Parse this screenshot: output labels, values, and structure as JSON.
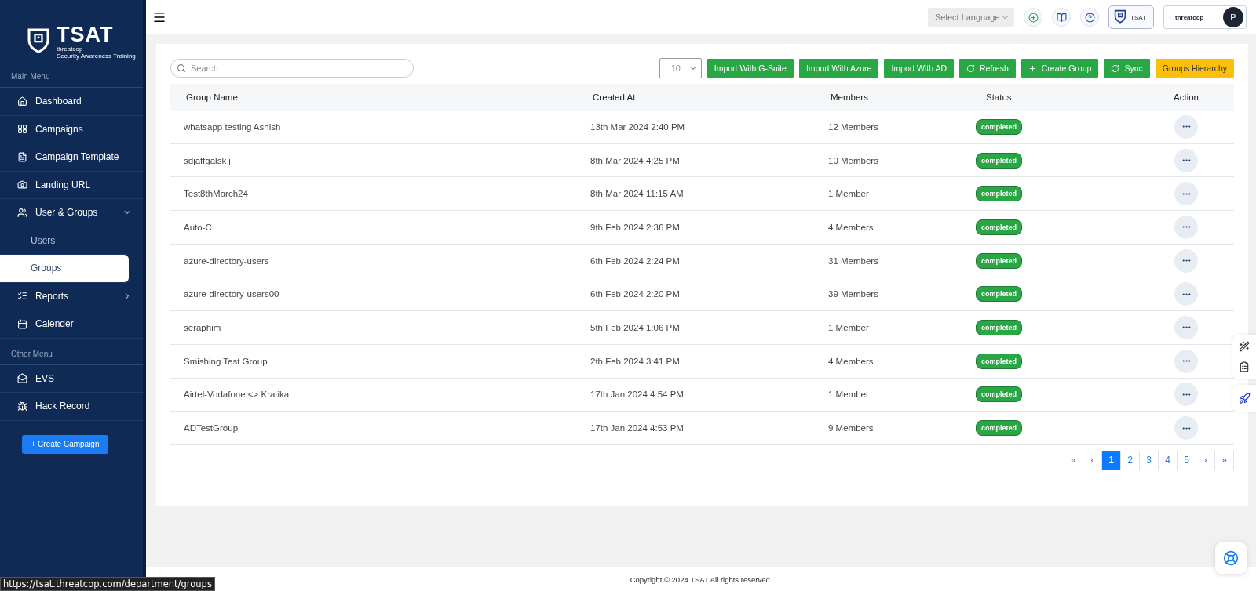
{
  "brand": {
    "title": "TSAT",
    "line_1": "threatcop",
    "line_2": "Security Awareness Training"
  },
  "main_menu": {
    "title": "Main Menu",
    "items": [
      {
        "label": "Dashboard",
        "kind": "item",
        "selected": false
      },
      {
        "label": "Campaigns",
        "kind": "item",
        "selected": false
      },
      {
        "label": "Campaign Template",
        "kind": "item",
        "selected": false
      },
      {
        "label": "Landing URL",
        "kind": "item",
        "selected": false
      },
      {
        "label": "User & Groups",
        "kind": "item",
        "selected": false,
        "expanded": true
      },
      {
        "label": "Users",
        "kind": "subitem",
        "selected": false
      },
      {
        "label": "Groups",
        "kind": "subitem",
        "selected": true
      },
      {
        "label": "Reports",
        "kind": "item",
        "selected": false,
        "expanded": false
      },
      {
        "label": "Calender",
        "kind": "item",
        "selected": false
      }
    ]
  },
  "other_menu": {
    "title": "Other Menu",
    "items": [
      {
        "label": "EVS",
        "kind": "item",
        "selected": false
      },
      {
        "label": "Hack Record",
        "kind": "item",
        "selected": false
      }
    ]
  },
  "create_campaign": "+ Create Campaign",
  "topbar": {
    "language": "Select Language",
    "product": "TSAT",
    "company": "threatcop",
    "avatar": "P"
  },
  "search": {
    "placeholder": "Search"
  },
  "page_size": "10",
  "buttons": [
    {
      "label": "Import With G-Suite",
      "kind": "import"
    },
    {
      "label": "Import With Azure",
      "kind": "import"
    },
    {
      "label": "Import With AD",
      "kind": "import"
    },
    {
      "label": "Refresh",
      "kind": "refresh"
    },
    {
      "label": "Create Group",
      "kind": "create"
    },
    {
      "label": "Sync",
      "kind": "sync"
    },
    {
      "label": "Groups Hierarchy",
      "kind": "hierarchy"
    }
  ],
  "table": {
    "columns": [
      "Group Name",
      "Created At",
      "Members",
      "Status",
      "Action"
    ],
    "rows": [
      {
        "name": "whatsapp testing Ashish",
        "created": "13th Mar 2024 2:40 PM",
        "members": "12 Members",
        "status": "completed"
      },
      {
        "name": "sdjaffgalsk j",
        "created": "8th Mar 2024 4:25 PM",
        "members": "10 Members",
        "status": "completed"
      },
      {
        "name": "Test8thMarch24",
        "created": "8th Mar 2024 11:15 AM",
        "members": "1 Member",
        "status": "completed"
      },
      {
        "name": "Auto-C",
        "created": "9th Feb 2024 2:36 PM",
        "members": "4 Members",
        "status": "completed"
      },
      {
        "name": "azure-directory-users",
        "created": "6th Feb 2024 2:24 PM",
        "members": "31 Members",
        "status": "completed"
      },
      {
        "name": "azure-directory-users00",
        "created": "6th Feb 2024 2:20 PM",
        "members": "39 Members",
        "status": "completed"
      },
      {
        "name": "seraphim",
        "created": "5th Feb 2024 1:06 PM",
        "members": "1 Member",
        "status": "completed"
      },
      {
        "name": "Smishing Test Group",
        "created": "2th Feb 2024 3:41 PM",
        "members": "4 Members",
        "status": "completed"
      },
      {
        "name": "Airtel-Vodafone <> Kratikal",
        "created": "17th Jan 2024 4:54 PM",
        "members": "1 Member",
        "status": "completed"
      },
      {
        "name": "ADTestGroup",
        "created": "17th Jan 2024 4:53 PM",
        "members": "9 Members",
        "status": "completed"
      }
    ]
  },
  "pagination": [
    {
      "label": "«",
      "selected": false
    },
    {
      "label": "‹",
      "selected": false
    },
    {
      "label": "1",
      "selected": true
    },
    {
      "label": "2",
      "selected": false
    },
    {
      "label": "3",
      "selected": false
    },
    {
      "label": "4",
      "selected": false
    },
    {
      "label": "5",
      "selected": false
    },
    {
      "label": "›",
      "selected": false
    },
    {
      "label": "»",
      "selected": false
    }
  ],
  "footer": "Copyright © 2024 TSAT All rights reserved.",
  "status_url": "https://tsat.threatcop.com/department/groups"
}
